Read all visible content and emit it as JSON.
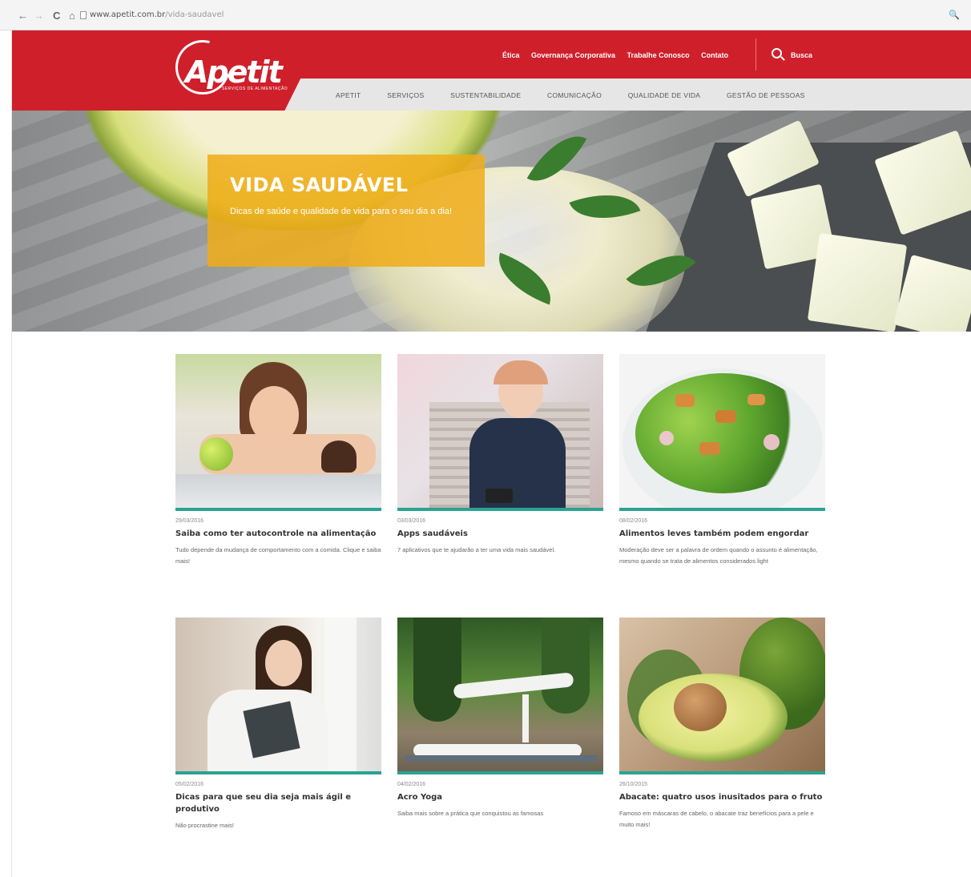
{
  "browser": {
    "back": "←",
    "forward": "→",
    "reload": "C",
    "home": "⌂",
    "url_host": "www.apetit.com.br",
    "url_path": "/vida-saudavel",
    "zoom": "🔍"
  },
  "header": {
    "logo_text": "Apetit",
    "logo_tag": "SERVIÇOS DE ALIMENTAÇÃO",
    "top_links": [
      "Ética",
      "Governança Corporativa",
      "Trabalhe Conosco",
      "Contato"
    ],
    "search_label": "Busca",
    "main_nav": [
      "APETIT",
      "SERVIÇOS",
      "SUSTENTABILIDADE",
      "COMUNICAÇÃO",
      "QUALIDADE DE VIDA",
      "GESTÃO DE PESSOAS"
    ],
    "brand_color": "#cf1f2b"
  },
  "hero": {
    "title": "VIDA SAUDÁVEL",
    "subtitle": "Dicas de saúde e qualidade de vida para o seu dia a dia!",
    "box_color": "#f0ac16"
  },
  "cards": [
    {
      "date": "29/03/2016",
      "title": "Saiba como ter autocontrole na alimentação",
      "desc": "Tudo depende da mudança de comportamento com a comida. Clique e saiba mais!"
    },
    {
      "date": "03/03/2016",
      "title": "Apps saudáveis",
      "desc": "7 aplicativos que te ajudarão a ter uma vida mais saudável."
    },
    {
      "date": "08/02/2016",
      "title": "Alimentos leves também podem engordar",
      "desc": "Moderação deve ser a palavra de ordem quando o assunto é alimentação, mesmo quando se trata de alimentos considerados light"
    },
    {
      "date": "05/02/2016",
      "title": "Dicas para que seu dia seja mais ágil e produtivo",
      "desc": "Não procrastine mais!"
    },
    {
      "date": "04/02/2016",
      "title": "Acro Yoga",
      "desc": "Saiba mais sobre a prática que conquistou as famosas"
    },
    {
      "date": "26/10/2015",
      "title": "Abacate: quatro usos inusitados para o fruto",
      "desc": "Famoso em máscaras de cabelo, o abacate traz benefícios para a pele e muito mais!"
    }
  ],
  "accent_color": "#2aa392"
}
